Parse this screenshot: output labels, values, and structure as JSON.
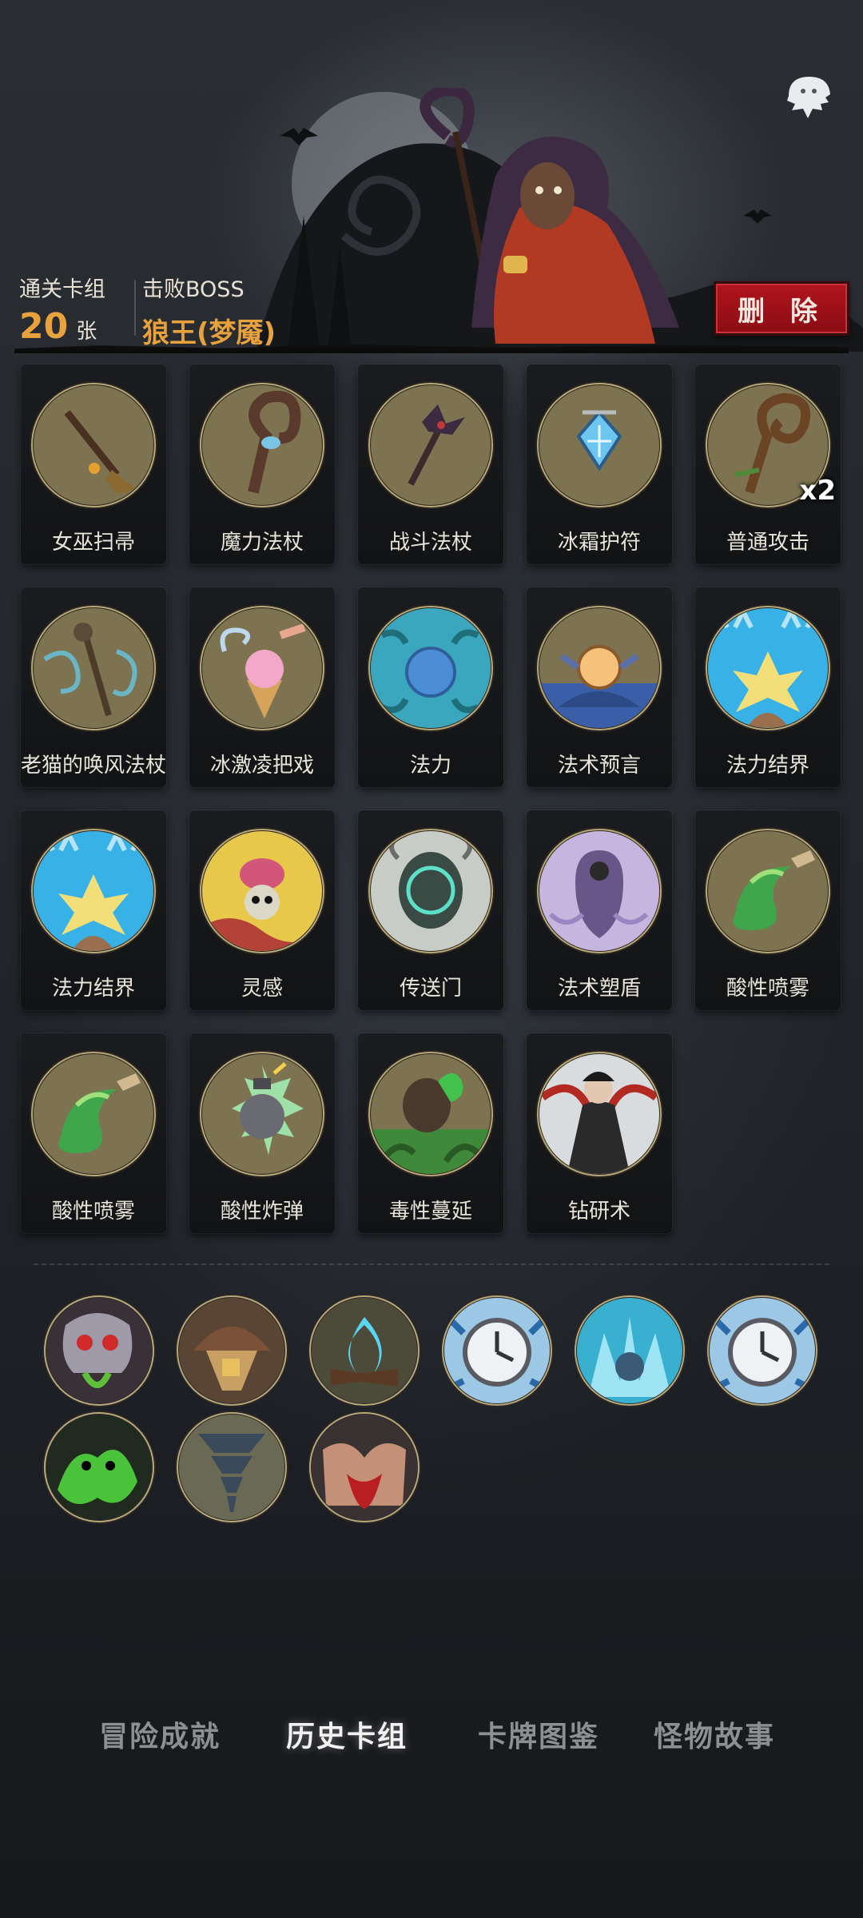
{
  "header": {
    "cleared_deck_label": "通关卡组",
    "card_count": "20",
    "card_unit": "张",
    "defeated_boss_label": "击败BOSS",
    "boss_name": "狼王(梦魇)",
    "delete_label": "删 除"
  },
  "cards": [
    {
      "name": "女巫扫帚",
      "icon": "broom-icon"
    },
    {
      "name": "魔力法杖",
      "icon": "magic-staff-icon"
    },
    {
      "name": "战斗法杖",
      "icon": "battle-staff-icon"
    },
    {
      "name": "冰霜护符",
      "icon": "frost-amulet-icon"
    },
    {
      "name": "普通攻击",
      "icon": "cane-icon",
      "count": "x2"
    },
    {
      "name": "老猫的唤风法杖",
      "icon": "wind-staff-icon"
    },
    {
      "name": "冰激凌把戏",
      "icon": "ice-cream-icon"
    },
    {
      "name": "法力",
      "icon": "mana-orb-icon"
    },
    {
      "name": "法术预言",
      "icon": "crystal-ball-icon"
    },
    {
      "name": "法力结界",
      "icon": "mana-barrier-icon"
    },
    {
      "name": "法力结界",
      "icon": "mana-barrier-icon"
    },
    {
      "name": "灵感",
      "icon": "brain-skull-icon"
    },
    {
      "name": "传送门",
      "icon": "portal-icon"
    },
    {
      "name": "法术塑盾",
      "icon": "shield-ghost-icon"
    },
    {
      "name": "酸性喷雾",
      "icon": "acid-spray-icon"
    },
    {
      "name": "酸性喷雾",
      "icon": "acid-spray-icon"
    },
    {
      "name": "酸性炸弹",
      "icon": "acid-bomb-icon"
    },
    {
      "name": "毒性蔓延",
      "icon": "poison-spread-icon"
    },
    {
      "name": "钻研术",
      "icon": "scholar-icon"
    }
  ],
  "relics": [
    {
      "icon": "skull-mask-icon"
    },
    {
      "icon": "basket-cheese-icon"
    },
    {
      "icon": "blue-campfire-icon"
    },
    {
      "icon": "frozen-clock-icon"
    },
    {
      "icon": "ice-spirit-icon"
    },
    {
      "icon": "frozen-clock-icon"
    },
    {
      "icon": "green-ghost-icon"
    },
    {
      "icon": "tornado-icon"
    },
    {
      "icon": "bloody-fist-icon"
    }
  ],
  "nav": {
    "tabs": [
      "冒险成就",
      "历史卡组",
      "卡牌图鉴",
      "怪物故事"
    ],
    "active_index": 1
  },
  "colors": {
    "accent": "#e7a23e",
    "delete_red": "#b2141d",
    "card_disc": "#7d7350",
    "card_disc_rim": "#2a2520"
  }
}
